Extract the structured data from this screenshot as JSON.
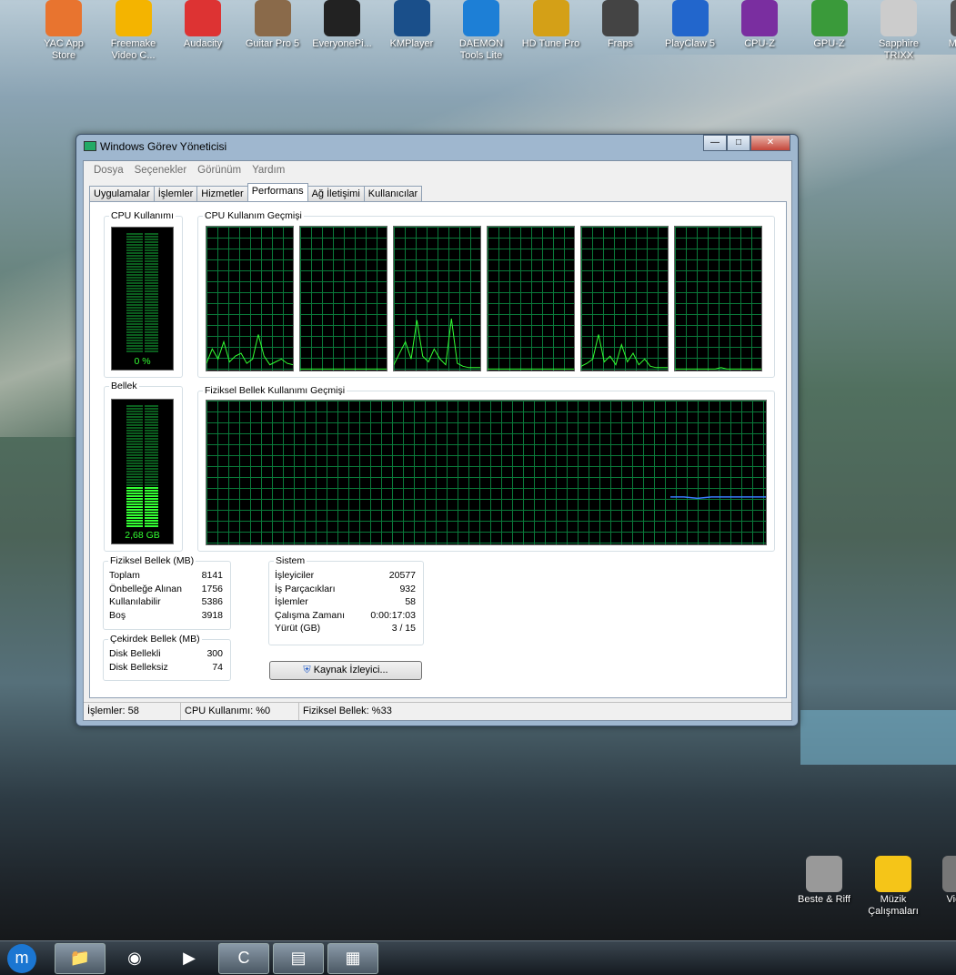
{
  "desktop": {
    "icons": [
      "YAC App Store",
      "Freemake Video C...",
      "Audacity",
      "Guitar Pro 5",
      "EveryonePi...",
      "KMPlayer",
      "DAEMON Tools Lite",
      "HD Tune Pro",
      "Fraps",
      "PlayClaw 5",
      "CPU-Z",
      "GPU-Z",
      "Sapphire TRIXX",
      "Msi Co..."
    ],
    "bottom_icons": [
      "Beste & Riff",
      "Müzik Çalışmaları",
      "Vide..."
    ]
  },
  "window": {
    "title": "Windows Görev Yöneticisi",
    "controls": {
      "minimize": "—",
      "maximize": "□",
      "close": "✕"
    },
    "menu": [
      "Dosya",
      "Seçenekler",
      "Görünüm",
      "Yardım"
    ],
    "tabs": [
      "Uygulamalar",
      "İşlemler",
      "Hizmetler",
      "Performans",
      "Ağ İletişimi",
      "Kullanıcılar"
    ],
    "active_tab": "Performans",
    "cpu_usage": {
      "label": "CPU Kullanımı",
      "value": "0 %",
      "percent": 0
    },
    "cpu_history": {
      "label": "CPU Kullanım Geçmişi",
      "cores": [
        [
          5,
          15,
          8,
          20,
          6,
          10,
          12,
          5,
          8,
          25,
          10,
          4,
          6,
          8,
          5,
          4
        ],
        [
          1,
          1,
          1,
          1,
          1,
          1,
          1,
          1,
          1,
          1,
          1,
          1,
          1,
          1,
          1,
          1
        ],
        [
          4,
          12,
          20,
          8,
          35,
          10,
          6,
          15,
          8,
          4,
          36,
          5,
          3,
          2,
          2,
          2
        ],
        [
          1,
          1,
          1,
          1,
          1,
          1,
          1,
          1,
          1,
          1,
          1,
          1,
          1,
          1,
          1,
          1
        ],
        [
          3,
          5,
          8,
          25,
          6,
          10,
          4,
          18,
          6,
          12,
          4,
          8,
          3,
          2,
          2,
          2
        ],
        [
          1,
          1,
          1,
          1,
          1,
          1,
          1,
          1,
          2,
          1,
          1,
          1,
          1,
          1,
          1,
          1
        ]
      ]
    },
    "memory": {
      "label": "Bellek",
      "value": "2,68 GB",
      "percent": 33
    },
    "memory_history": {
      "label": "Fiziksel Bellek Kullanımı Geçmişi",
      "values": [
        33,
        33,
        32,
        33,
        33,
        33,
        33,
        33
      ]
    },
    "physical_memory": {
      "label": "Fiziksel Bellek (MB)",
      "rows": [
        [
          "Toplam",
          "8141"
        ],
        [
          "Önbelleğe Alınan",
          "1756"
        ],
        [
          "Kullanılabilir",
          "5386"
        ],
        [
          "Boş",
          "3918"
        ]
      ]
    },
    "kernel_memory": {
      "label": "Çekirdek Bellek (MB)",
      "rows": [
        [
          "Disk Bellekli",
          "300"
        ],
        [
          "Disk Belleksiz",
          "74"
        ]
      ]
    },
    "system": {
      "label": "Sistem",
      "rows": [
        [
          "İşleyiciler",
          "20577"
        ],
        [
          "İş Parçacıkları",
          "932"
        ],
        [
          "İşlemler",
          "58"
        ],
        [
          "Çalışma Zamanı",
          "0:00:17:03"
        ],
        [
          "Yürüt (GB)",
          "3 / 15"
        ]
      ]
    },
    "resource_monitor_button": "Kaynak İzleyici...",
    "status": [
      "İşlemler: 58",
      "CPU Kullanımı: %0",
      "Fiziksel Bellek: %33"
    ]
  },
  "colors": {
    "graph_line": "#33ff33",
    "memory_line": "#3a7bff",
    "grid": "#0a7a3a"
  }
}
